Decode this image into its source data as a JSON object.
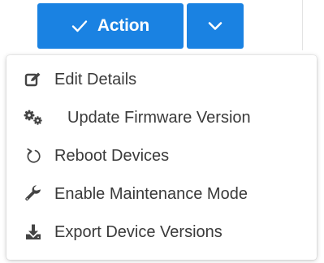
{
  "action_button": {
    "label": "Action",
    "check_icon": "check-icon",
    "caret_icon": "chevron-down-icon"
  },
  "menu": {
    "items": [
      {
        "label": "Edit Details",
        "icon": "edit-icon"
      },
      {
        "label": "Update Firmware Version",
        "icon": "gears-icon"
      },
      {
        "label": "Reboot Devices",
        "icon": "undo-icon"
      },
      {
        "label": "Enable Maintenance Mode",
        "icon": "wrench-icon"
      },
      {
        "label": "Export Device Versions",
        "icon": "download-icon"
      }
    ]
  },
  "colors": {
    "primary": "#1a82e2",
    "menu_text": "#3a3a3a",
    "menu_icon": "#444444"
  }
}
